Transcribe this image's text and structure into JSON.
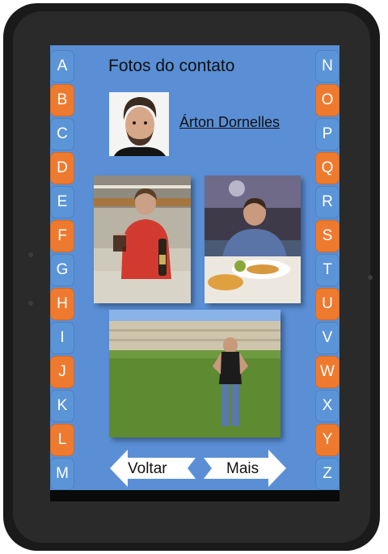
{
  "header": {
    "title": "Fotos do contato"
  },
  "contact": {
    "name": "Árton Dornelles"
  },
  "alphabet": {
    "left": [
      "A",
      "B",
      "C",
      "D",
      "E",
      "F",
      "G",
      "H",
      "I",
      "J",
      "K",
      "L",
      "M"
    ],
    "right": [
      "N",
      "O",
      "P",
      "Q",
      "R",
      "S",
      "T",
      "U",
      "V",
      "W",
      "X",
      "Y",
      "Z"
    ]
  },
  "navigation": {
    "back_label": "Voltar",
    "more_label": "Mais"
  },
  "colors": {
    "screen": "#5a8fd6",
    "letter_blue": "#5b95d8",
    "letter_orange": "#ee7a2f",
    "bezel": "#1a1a1a"
  }
}
